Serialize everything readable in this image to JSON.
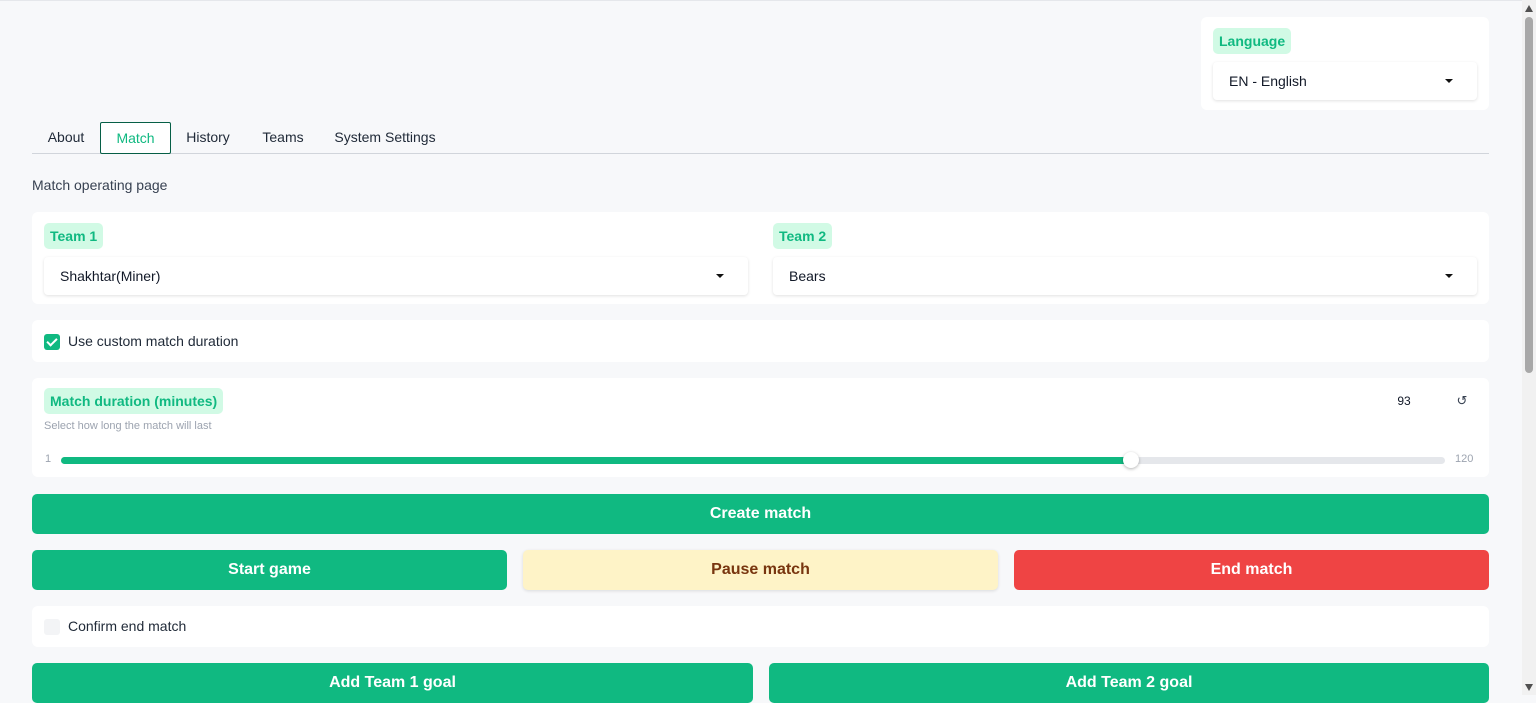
{
  "language": {
    "label": "Language",
    "selected": "EN - English"
  },
  "tabs": [
    {
      "label": "About",
      "active": false
    },
    {
      "label": "Match",
      "active": true
    },
    {
      "label": "History",
      "active": false
    },
    {
      "label": "Teams",
      "active": false
    },
    {
      "label": "System Settings",
      "active": false
    }
  ],
  "page_subtitle": "Match operating page",
  "team1": {
    "label": "Team 1",
    "selected": "Shakhtar(Miner)"
  },
  "team2": {
    "label": "Team 2",
    "selected": "Bears"
  },
  "custom_duration": {
    "label": "Use custom match duration",
    "checked": true
  },
  "duration": {
    "label": "Match duration (minutes)",
    "hint": "Select how long the match will last",
    "min": "1",
    "max": "120",
    "value": "93",
    "reset_icon": "↺"
  },
  "buttons": {
    "create": "Create match",
    "start": "Start game",
    "pause": "Pause match",
    "end": "End match",
    "goal1": "Add Team 1 goal",
    "goal2": "Add Team 2 goal"
  },
  "confirm_end": {
    "label": "Confirm end match",
    "checked": false
  },
  "colors": {
    "accent": "#10b981",
    "danger": "#ef4444",
    "warning_bg": "#fef3c7"
  }
}
